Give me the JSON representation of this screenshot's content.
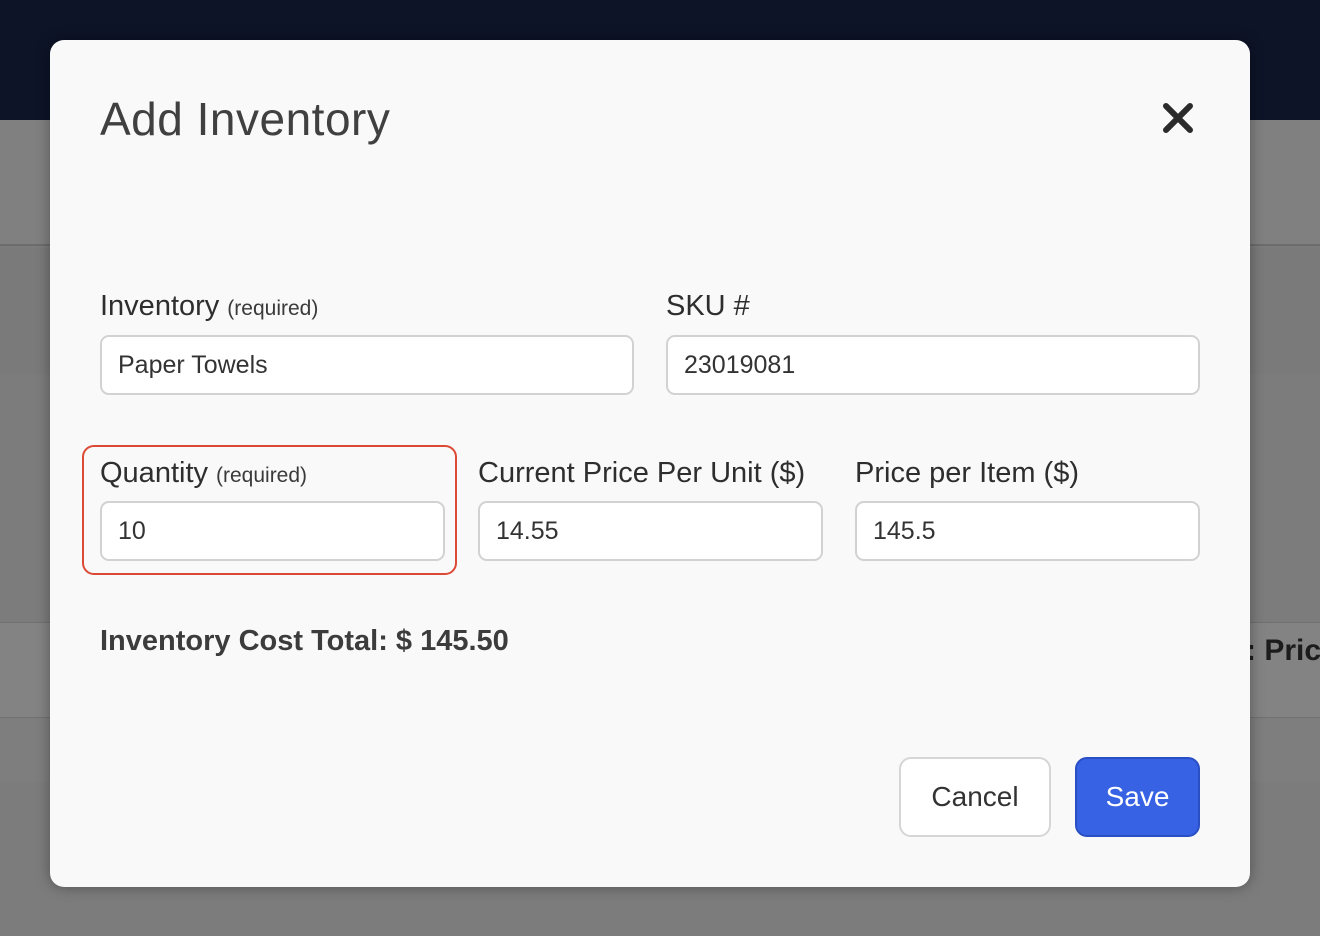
{
  "background": {
    "peek_text": ": Price"
  },
  "modal": {
    "title": "Add Inventory",
    "close_icon": "close-icon"
  },
  "form": {
    "inventory": {
      "label": "Inventory",
      "required_note": "(required)",
      "value": "Paper Towels"
    },
    "sku": {
      "label": "SKU #",
      "value": "23019081"
    },
    "quantity": {
      "label": "Quantity",
      "required_note": "(required)",
      "value": "10"
    },
    "current_price": {
      "label": "Current Price Per Unit ($)",
      "value": "14.55"
    },
    "price_per_item": {
      "label": "Price per Item ($)",
      "value": "145.5"
    }
  },
  "summary": {
    "total_text": "Inventory Cost Total: $ 145.50"
  },
  "actions": {
    "cancel_label": "Cancel",
    "save_label": "Save"
  },
  "colors": {
    "topbar": "#0d1427",
    "primary": "#3862e4",
    "focus_ring": "#dc4a36"
  }
}
